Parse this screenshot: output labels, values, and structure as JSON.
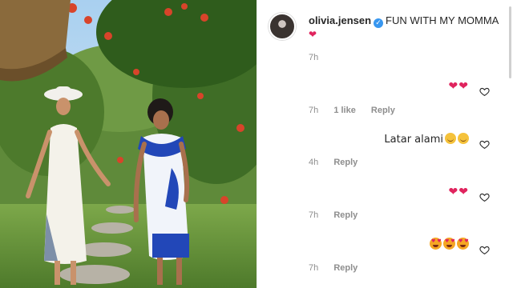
{
  "caption": {
    "username": "olivia.jensen",
    "text": "FUN WITH MY MOMMA",
    "time": "7h"
  },
  "comments": [
    {
      "body_emoji": "heart-heart",
      "time": "7h",
      "likes": "1 like",
      "reply": "Reply"
    },
    {
      "body_text": "Latar alami",
      "body_emoji": "smile-smile",
      "time": "4h",
      "reply": "Reply"
    },
    {
      "body_emoji": "heart-heart",
      "time": "7h",
      "reply": "Reply"
    },
    {
      "body_emoji": "hearteyes-x3",
      "time": "7h",
      "reply": "Reply"
    }
  ],
  "colors": {
    "accent": "#3897f0",
    "heart": "#e0245e",
    "muted": "#8e8e8e",
    "text": "#262626"
  }
}
